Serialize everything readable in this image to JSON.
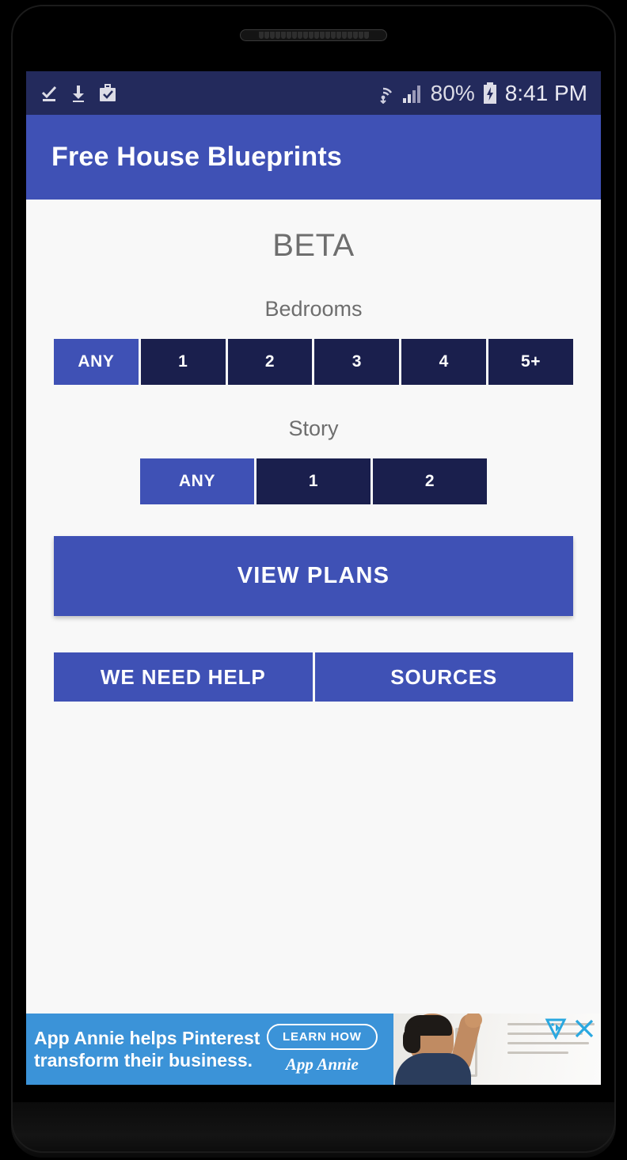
{
  "statusbar": {
    "icons_left": [
      "check-underline-icon",
      "download-icon",
      "briefcase-check-icon"
    ],
    "icons_right": [
      "wifi-icon",
      "signal-icon",
      "battery-charging-icon"
    ],
    "battery_percent": "80%",
    "clock": "8:41 PM"
  },
  "appbar": {
    "title": "Free House Blueprints"
  },
  "content": {
    "beta_label": "BETA",
    "bedrooms": {
      "label": "Bedrooms",
      "options": [
        "ANY",
        "1",
        "2",
        "3",
        "4",
        "5+"
      ],
      "selected": "ANY"
    },
    "story": {
      "label": "Story",
      "options": [
        "ANY",
        "1",
        "2"
      ],
      "selected": "ANY"
    },
    "view_plans_label": "VIEW PLANS",
    "we_need_help_label": "WE NEED HELP",
    "sources_label": "SOURCES"
  },
  "ad": {
    "headline": "App Annie helps Pinterest transform their business.",
    "cta_label": "LEARN HOW",
    "brand": "App Annie",
    "adchoices_icon": "adchoices-icon",
    "close_icon": "close-icon"
  },
  "colors": {
    "accent": "#3f51b5",
    "segment_unselected": "#1a1f4d",
    "statusbar": "#232a5c",
    "page_background": "#f8f8f8",
    "ad_background": "#3b93d8"
  }
}
